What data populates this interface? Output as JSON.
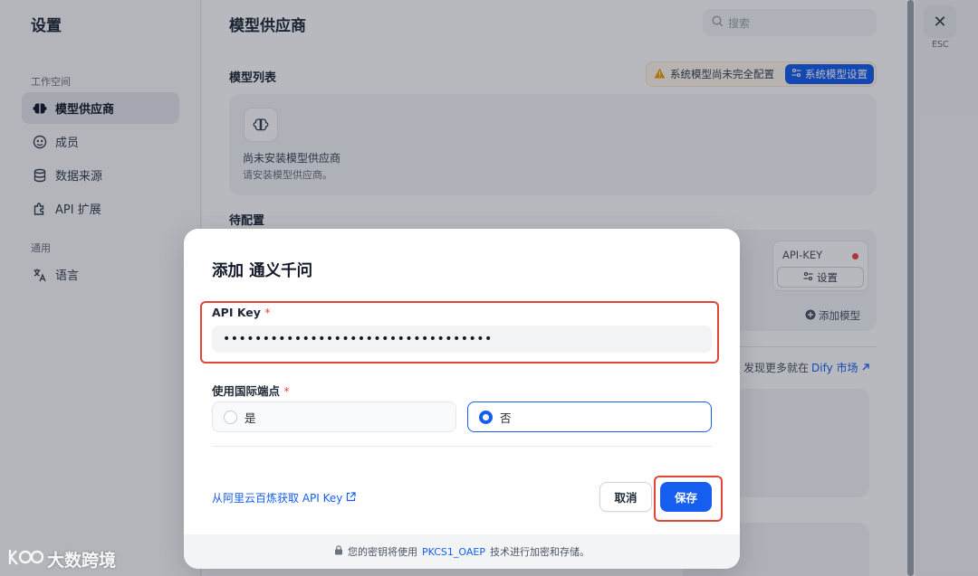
{
  "left_panel": {
    "title": "设置",
    "workspace_label": "工作空间",
    "general_label": "通用",
    "items": [
      {
        "label": "模型供应商"
      },
      {
        "label": "成员"
      },
      {
        "label": "数据来源"
      },
      {
        "label": "API 扩展"
      },
      {
        "label": "语言"
      }
    ]
  },
  "main": {
    "title": "模型供应商",
    "search_placeholder": "搜索",
    "model_list_label": "模型列表",
    "warning_text": "系统模型尚未完全配置",
    "system_model_button": "系统模型设置",
    "empty_title": "尚未安装模型供应商",
    "empty_sub": "请安装模型供应商。",
    "pending_label": "待配置",
    "apikey_label": "API-KEY",
    "setup_button": "设置",
    "add_model": "添加模型",
    "discover_prefix": "发现更多就在",
    "discover_link": "Dify 市场"
  },
  "close": {
    "icon": "✕",
    "label": "ESC"
  },
  "modal": {
    "title": "添加 通义千问",
    "api_key_label": "API Key",
    "required_mark": "*",
    "api_key_value": "••••••••••••••••••••••••••••••••••",
    "intl_label": "使用国际端点",
    "option_yes": "是",
    "option_no": "否",
    "selected_option": "否",
    "get_key_link": "从阿里云百炼获取 API Key",
    "cancel_button": "取消",
    "save_button": "保存",
    "footer_prefix": "您的密钥将使用",
    "footer_highlight": "PKCS1_OAEP",
    "footer_suffix": "技术进行加密和存储。"
  },
  "watermark": "大数跨境",
  "colors": {
    "primary": "#155eef",
    "highlight": "#e2463a",
    "danger": "#ef4444"
  }
}
